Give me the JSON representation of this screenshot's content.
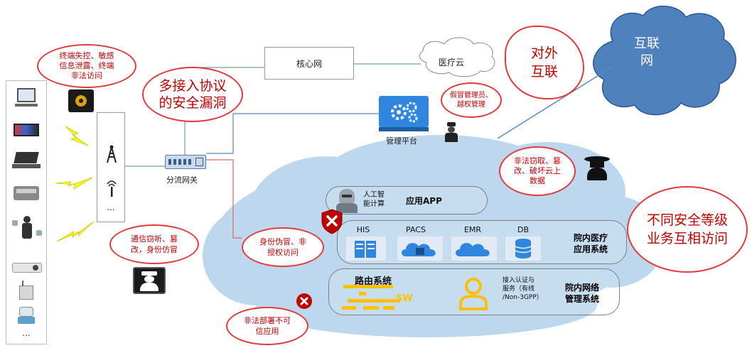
{
  "network": {
    "core_network": "核心网",
    "medical_cloud": "医疗云",
    "internet": "互联\n网",
    "management_platform": "管理平台",
    "shunt_gateway": "分流网关",
    "ap_more": "..."
  },
  "cloud": {
    "app_lane": {
      "ai_label": "人工智\n能计算",
      "title": "应用APP"
    },
    "medical_lane": {
      "systems": [
        "HIS",
        "PACS",
        "EMR",
        "DB"
      ],
      "title": "院内医疗\n应用系统"
    },
    "network_lane": {
      "routing": "路由系统",
      "sw": "SW",
      "auth": "接入认证与\n服务（有线\n/Non-3GPP）",
      "title": "院内网络\n管理系统"
    }
  },
  "devices": {
    "more": "..."
  },
  "threats": {
    "terminal": "终端失控、敏感\n信息泄露、终端\n非法访问",
    "protocol": "多接入协议\n的安全漏洞",
    "external": "对外\n互联",
    "admin": "假冒管理员、\n越权管理",
    "cloud_attack": "非法窃取、篡\n改、破坏云上\n数据",
    "cross_level": "不同安全等级\n业务互相访问",
    "comm": "通信窃听、篡\n改，身份仿冒",
    "identity": "身份伪冒、非\n授权访问",
    "illegal_app": "非法部署不可\n信应用"
  },
  "colors": {
    "threat_red": "#e23b3b",
    "cloud_fill": "#bdd7ee",
    "internet_fill": "#4472c4",
    "icon_blue": "#2e86de",
    "routing_yellow": "#ffc000"
  }
}
